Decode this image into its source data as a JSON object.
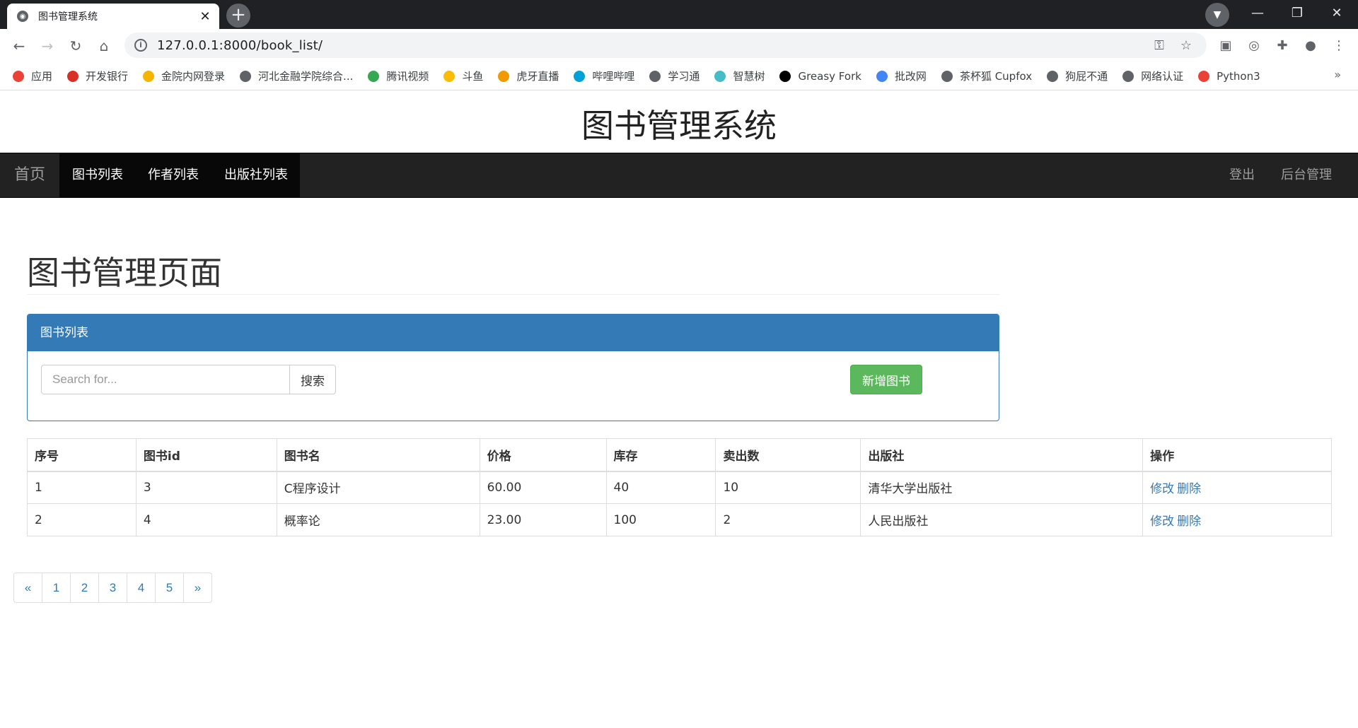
{
  "browser": {
    "tab_title": "图书管理系统",
    "tab_close": "✕",
    "new_tab": "+",
    "url": "127.0.0.1:8000/book_list/",
    "window_controls": {
      "minimize": "—",
      "restore": "❐",
      "close": "✕"
    }
  },
  "bookmarks": [
    {
      "label": "应用",
      "color": "#ea4335"
    },
    {
      "label": "开发银行",
      "color": "#d93025"
    },
    {
      "label": "金院内网登录",
      "color": "#f4b400"
    },
    {
      "label": "河北金融学院综合...",
      "color": "#5f6368"
    },
    {
      "label": "腾讯视频",
      "color": "#34a853"
    },
    {
      "label": "斗鱼",
      "color": "#fbbc05"
    },
    {
      "label": "虎牙直播",
      "color": "#f29900"
    },
    {
      "label": "哔哩哔哩",
      "color": "#00a1d6"
    },
    {
      "label": "学习通",
      "color": "#5f6368"
    },
    {
      "label": "智慧树",
      "color": "#46bdc6"
    },
    {
      "label": "Greasy Fork",
      "color": "#000000"
    },
    {
      "label": "批改网",
      "color": "#4285f4"
    },
    {
      "label": "茶杯狐 Cupfox",
      "color": "#5f6368"
    },
    {
      "label": "狗屁不通",
      "color": "#5f6368"
    },
    {
      "label": "网络认证",
      "color": "#5f6368"
    },
    {
      "label": "Python3",
      "color": "#ea4335"
    }
  ],
  "site": {
    "title": "图书管理系统"
  },
  "navbar": {
    "brand": "首页",
    "links": [
      "图书列表",
      "作者列表",
      "出版社列表"
    ],
    "right": [
      "登出",
      "后台管理"
    ]
  },
  "page": {
    "heading": "图书管理页面"
  },
  "panel": {
    "title": "图书列表",
    "search_placeholder": "Search for...",
    "search_button": "搜索",
    "add_button": "新增图书"
  },
  "table": {
    "headers": [
      "序号",
      "图书id",
      "图书名",
      "价格",
      "库存",
      "卖出数",
      "出版社",
      "操作"
    ],
    "rows": [
      {
        "index": "1",
        "id": "3",
        "name": "C程序设计",
        "price": "60.00",
        "stock": "40",
        "sold": "10",
        "publisher": "清华大学出版社",
        "edit": "修改",
        "delete": "删除"
      },
      {
        "index": "2",
        "id": "4",
        "name": "概率论",
        "price": "23.00",
        "stock": "100",
        "sold": "2",
        "publisher": "人民出版社",
        "edit": "修改",
        "delete": "删除"
      }
    ]
  },
  "pagination": [
    "«",
    "1",
    "2",
    "3",
    "4",
    "5",
    "»"
  ],
  "colors": {
    "primary": "#337ab7",
    "success": "#5cb85c",
    "navbar": "#222222"
  }
}
